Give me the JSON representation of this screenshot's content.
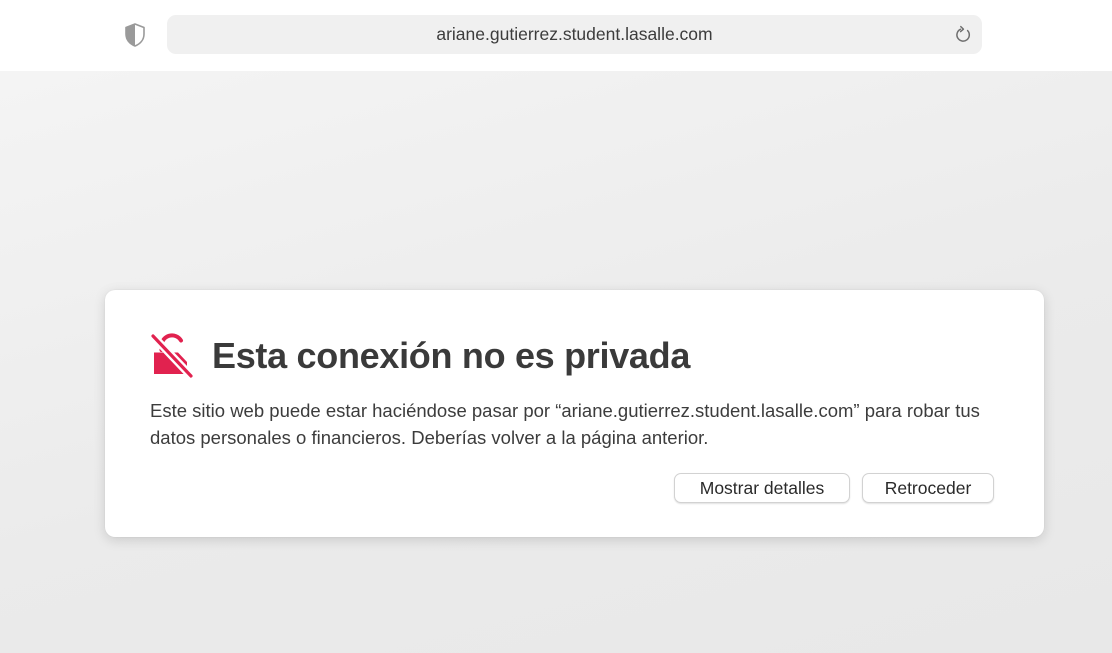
{
  "toolbar": {
    "privacy_icon": "shield-icon",
    "address": "ariane.gutierrez.student.lasalle.com",
    "reload_icon": "reload-icon"
  },
  "warning": {
    "icon": "broken-lock-icon",
    "icon_color": "#e1224f",
    "title": "Esta conexión no es privada",
    "message": "Este sitio web puede estar haciéndose pasar por “ariane.gutierrez.student.lasalle.com” para robar tus datos personales o financieros. Deberías volver a la página anterior.",
    "buttons": {
      "details": "Mostrar detalles",
      "back": "Retroceder"
    }
  }
}
